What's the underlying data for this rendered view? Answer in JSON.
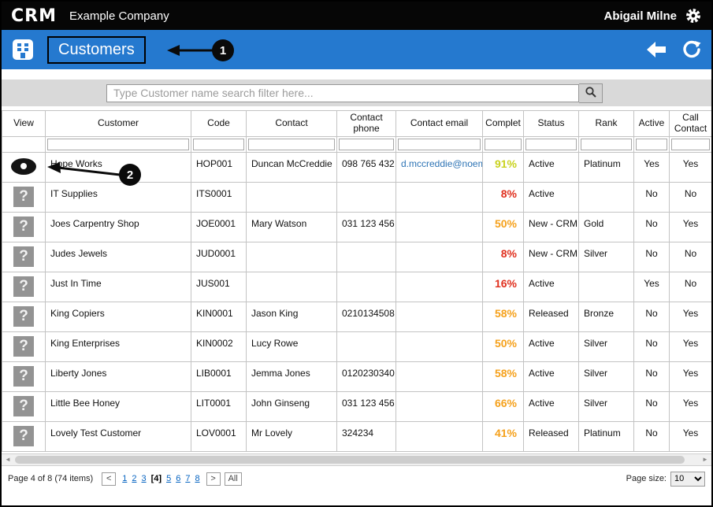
{
  "topbar": {
    "logo": "CRM",
    "company": "Example Company",
    "user": "Abigail Milne"
  },
  "navbar": {
    "title": "Customers"
  },
  "search": {
    "placeholder": "Type Customer name search filter here..."
  },
  "colors": {
    "accent_blue": "#2579cf",
    "link_blue": "#0563c1",
    "email_blue": "#2e74b5",
    "percent_yellow": "#c9d21f",
    "percent_orange": "#f5a11c",
    "percent_red": "#e0301e"
  },
  "icons": {
    "question_glyph": "?",
    "scroll_left": "◄",
    "scroll_right": "►"
  },
  "table": {
    "columns": [
      {
        "key": "view",
        "label": "View"
      },
      {
        "key": "customer",
        "label": "Customer"
      },
      {
        "key": "code",
        "label": "Code"
      },
      {
        "key": "contact",
        "label": "Contact"
      },
      {
        "key": "phone",
        "label": "Contact phone"
      },
      {
        "key": "email",
        "label": "Contact email"
      },
      {
        "key": "complete",
        "label": "Complet"
      },
      {
        "key": "status",
        "label": "Status"
      },
      {
        "key": "rank",
        "label": "Rank"
      },
      {
        "key": "active",
        "label": "Active"
      },
      {
        "key": "call",
        "label": "Call Contact"
      }
    ],
    "rows": [
      {
        "icon": "eye",
        "customer": "Hope Works",
        "code": "HOP001",
        "contact": "Duncan McCreddie",
        "phone": "098 765 432",
        "email": "d.mccreddie@noem",
        "complete": "91%",
        "complete_color": "#c9d21f",
        "status": "Active",
        "rank": "Platinum",
        "active": "Yes",
        "call": "Yes"
      },
      {
        "icon": "question",
        "customer": "IT Supplies",
        "code": "ITS0001",
        "contact": "",
        "phone": "",
        "email": "",
        "complete": "8%",
        "complete_color": "#e0301e",
        "status": "Active",
        "rank": "",
        "active": "No",
        "call": "No"
      },
      {
        "icon": "question",
        "customer": "Joes Carpentry Shop",
        "code": "JOE0001",
        "contact": "Mary Watson",
        "phone": "031 123 456",
        "email": "",
        "complete": "50%",
        "complete_color": "#f5a11c",
        "status": "New - CRM",
        "rank": "Gold",
        "active": "No",
        "call": "Yes"
      },
      {
        "icon": "question",
        "customer": "Judes Jewels",
        "code": "JUD0001",
        "contact": "",
        "phone": "",
        "email": "",
        "complete": "8%",
        "complete_color": "#e0301e",
        "status": "New - CRM",
        "rank": "Silver",
        "active": "No",
        "call": "No"
      },
      {
        "icon": "question",
        "customer": "Just In Time",
        "code": "JUS001",
        "contact": "",
        "phone": "",
        "email": "",
        "complete": "16%",
        "complete_color": "#e0301e",
        "status": "Active",
        "rank": "",
        "active": "Yes",
        "call": "No"
      },
      {
        "icon": "question",
        "customer": "King Copiers",
        "code": "KIN0001",
        "contact": "Jason King",
        "phone": "0210134508",
        "email": "",
        "complete": "58%",
        "complete_color": "#f5a11c",
        "status": "Released",
        "rank": "Bronze",
        "active": "No",
        "call": "Yes"
      },
      {
        "icon": "question",
        "customer": "King Enterprises",
        "code": "KIN0002",
        "contact": "Lucy Rowe",
        "phone": "",
        "email": "",
        "complete": "50%",
        "complete_color": "#f5a11c",
        "status": "Active",
        "rank": "Silver",
        "active": "No",
        "call": "Yes"
      },
      {
        "icon": "question",
        "customer": "Liberty Jones",
        "code": "LIB0001",
        "contact": "Jemma Jones",
        "phone": "0120230340",
        "email": "",
        "complete": "58%",
        "complete_color": "#f5a11c",
        "status": "Active",
        "rank": "Silver",
        "active": "No",
        "call": "Yes"
      },
      {
        "icon": "question",
        "customer": "Little Bee Honey",
        "code": "LIT0001",
        "contact": "John Ginseng",
        "phone": "031 123 456",
        "email": "",
        "complete": "66%",
        "complete_color": "#f5a11c",
        "status": "Active",
        "rank": "Silver",
        "active": "No",
        "call": "Yes"
      },
      {
        "icon": "question",
        "customer": "Lovely Test Customer",
        "code": "LOV0001",
        "contact": "Mr Lovely",
        "phone": "324234",
        "email": "",
        "complete": "41%",
        "complete_color": "#f5a11c",
        "status": "Released",
        "rank": "Platinum",
        "active": "No",
        "call": "Yes"
      }
    ]
  },
  "pager": {
    "info": "Page 4 of 8 (74 items)",
    "prev_label": "<",
    "next_label": ">",
    "all_label": "All",
    "pages": [
      {
        "label": "1",
        "current": false
      },
      {
        "label": "2",
        "current": false
      },
      {
        "label": "3",
        "current": false
      },
      {
        "label": "[4]",
        "current": true
      },
      {
        "label": "5",
        "current": false
      },
      {
        "label": "6",
        "current": false
      },
      {
        "label": "7",
        "current": false
      },
      {
        "label": "8",
        "current": false
      }
    ],
    "page_size_label": "Page size:",
    "page_size": "10",
    "page_size_options": [
      "10"
    ]
  },
  "annotations": {
    "callouts": [
      {
        "label": "1"
      },
      {
        "label": "2"
      }
    ]
  }
}
